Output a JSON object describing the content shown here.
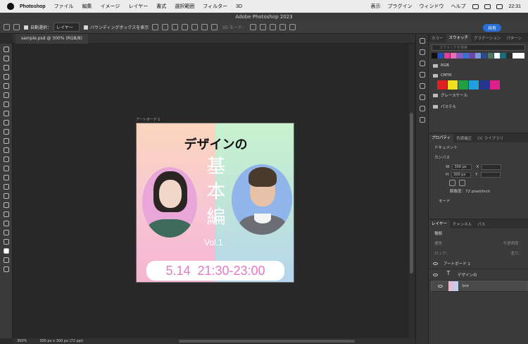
{
  "menubar": {
    "app": "Photoshop",
    "items": [
      "ファイル",
      "編集",
      "イメージ",
      "レイヤー",
      "書式",
      "選択範囲",
      "フィルター",
      "3D"
    ],
    "right_items": [
      "表示",
      "プラグイン",
      "ウィンドウ",
      "ヘルプ"
    ],
    "time": "22:31"
  },
  "window_title": "Adobe Photoshop 2023",
  "options": {
    "auto_select": "自動選択：",
    "auto_select_target": "レイヤー",
    "bounding_box": "バウンディングボックスを表示",
    "mode_3d": "3D モード：",
    "share": "共有"
  },
  "document_tab": "sample.psd @ 300% (RGB/8)",
  "artboard_label": "アートボード 1",
  "artwork": {
    "title": "デザインの",
    "main": [
      "基",
      "本",
      "編"
    ],
    "vol": "Vol.1",
    "date": "5.14  21:30-23:00"
  },
  "status": {
    "zoom": "300%",
    "doc": "300 px x 300 px (72 ppi)"
  },
  "swatches_panel": {
    "tabs": [
      "カラー",
      "スウォッチ",
      "グラデーション",
      "パターン"
    ],
    "search_placeholder": "スウォッチを検索",
    "top_colors": [
      "#111111",
      "#1f4fbf",
      "#e0409a",
      "#e870b0",
      "#8a5cc0",
      "#3b6fd0",
      "#6a4aa8",
      "#7a9ad8",
      "#2a4a8a",
      "#4a7a6a",
      "#ffffff",
      "#1b6b7a",
      "#2e2e2e",
      "#ffffff",
      "#ffffff"
    ],
    "folders": [
      "RGB",
      "CMYK",
      "グレースケール",
      "パステル"
    ],
    "cmyk_colors": [
      "#e02020",
      "#f0e020",
      "#20a040",
      "#20a0e0",
      "#203890",
      "#e0208a"
    ]
  },
  "properties_panel": {
    "tabs": [
      "プロパティ",
      "色調補正",
      "CC ライブラリ"
    ],
    "doc_label": "ドキュメント",
    "canvas_label": "カンバス",
    "w_label": "W",
    "w_value": "300 px",
    "h_label": "H",
    "h_value": "300 px",
    "x_label": "X",
    "y_label": "Y",
    "resolution": "解像度：72 pixel/inch",
    "mode": "モード"
  },
  "layers_panel": {
    "tabs": [
      "レイヤー",
      "チャンネル",
      "パス"
    ],
    "filter": "種類",
    "blend": "通常",
    "opacity": "不透明度：",
    "lock": "ロック：",
    "fill": "塗り：",
    "layers": [
      {
        "name": "アートボード 1",
        "type": "group"
      },
      {
        "name": "デザインの",
        "type": "text"
      },
      {
        "name": "bnr",
        "type": "image"
      }
    ]
  }
}
